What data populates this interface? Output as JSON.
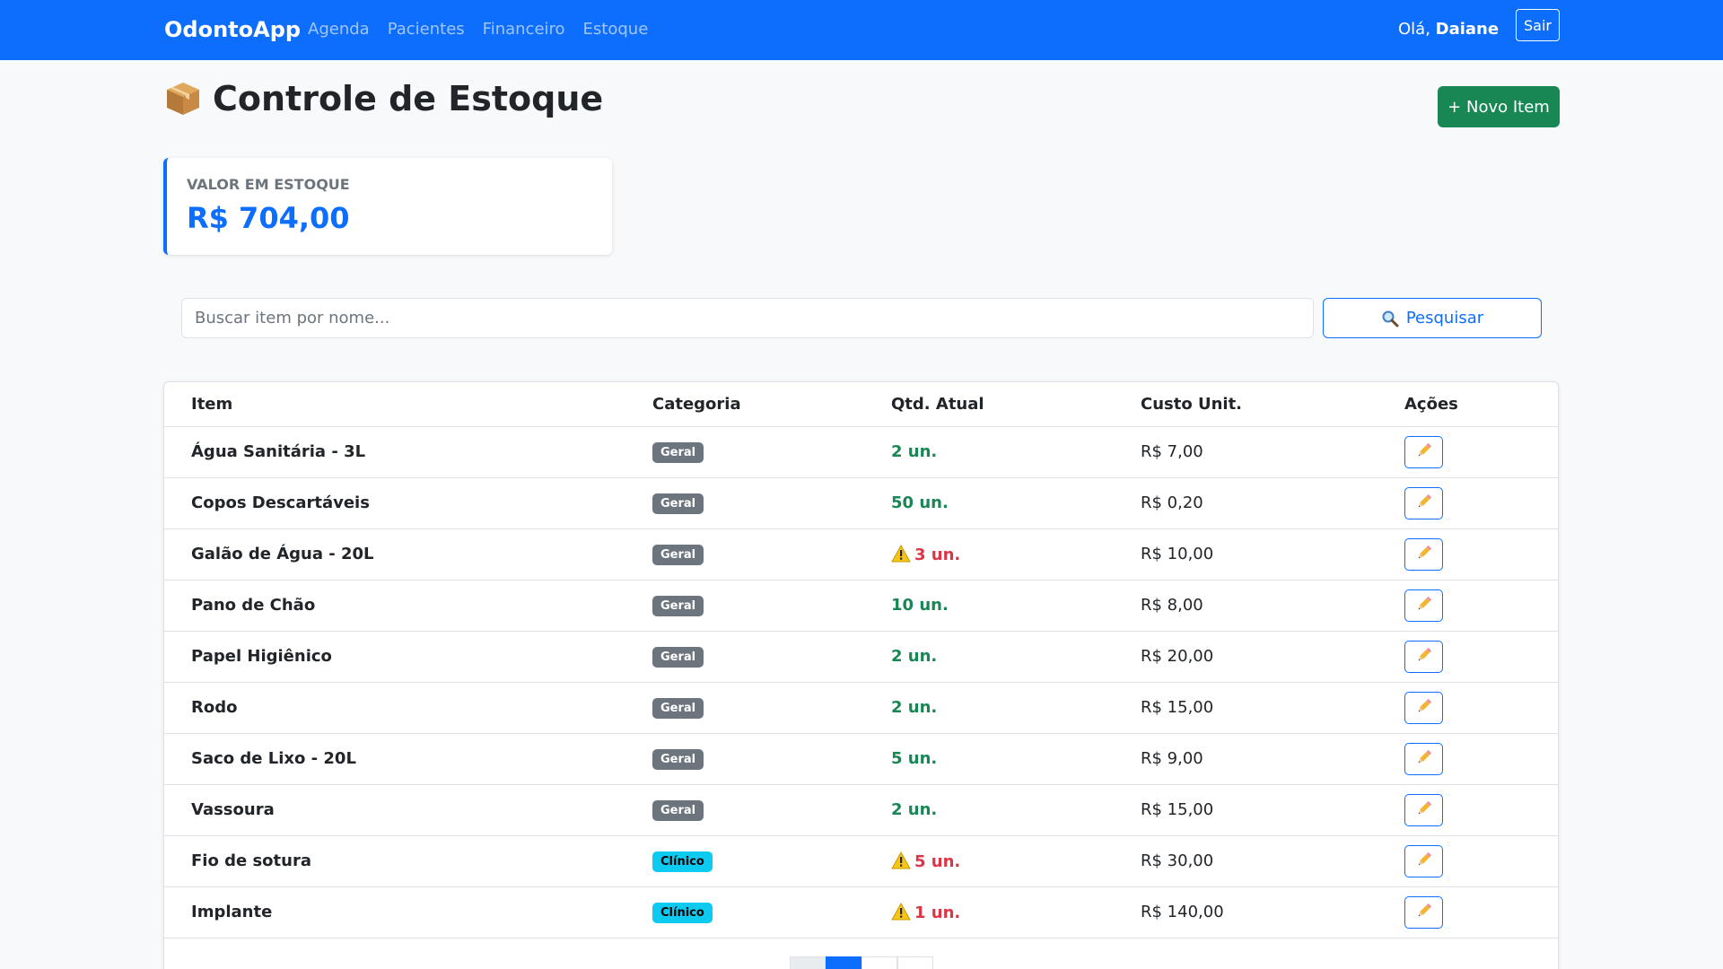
{
  "navbar": {
    "brand": "OdontoApp",
    "links": [
      "Agenda",
      "Pacientes",
      "Financeiro",
      "Estoque"
    ],
    "greeting_prefix": "Olá,",
    "user_name": "Daiane",
    "logout_label": "Sair"
  },
  "header": {
    "title": "Controle de Estoque",
    "title_icon": "package-icon",
    "new_item_label": "+ Novo Item"
  },
  "stat": {
    "label": "VALOR EM ESTOQUE",
    "value": "R$ 704,00"
  },
  "search": {
    "placeholder": "Buscar item por nome...",
    "value": "",
    "button_label": "Pesquisar"
  },
  "table": {
    "columns": [
      "Item",
      "Categoria",
      "Qtd. Atual",
      "Custo Unit.",
      "Ações"
    ],
    "rows": [
      {
        "item": "Água Sanitária - 3L",
        "category": "Geral",
        "qty": "2 un.",
        "low": false,
        "cost": "R$ 7,00"
      },
      {
        "item": "Copos Descartáveis",
        "category": "Geral",
        "qty": "50 un.",
        "low": false,
        "cost": "R$ 0,20"
      },
      {
        "item": "Galão de Água - 20L",
        "category": "Geral",
        "qty": "3 un.",
        "low": true,
        "cost": "R$ 10,00"
      },
      {
        "item": "Pano de Chão",
        "category": "Geral",
        "qty": "10 un.",
        "low": false,
        "cost": "R$ 8,00"
      },
      {
        "item": "Papel Higiênico",
        "category": "Geral",
        "qty": "2 un.",
        "low": false,
        "cost": "R$ 20,00"
      },
      {
        "item": "Rodo",
        "category": "Geral",
        "qty": "2 un.",
        "low": false,
        "cost": "R$ 15,00"
      },
      {
        "item": "Saco de Lixo - 20L",
        "category": "Geral",
        "qty": "5 un.",
        "low": false,
        "cost": "R$ 9,00"
      },
      {
        "item": "Vassoura",
        "category": "Geral",
        "qty": "2 un.",
        "low": false,
        "cost": "R$ 15,00"
      },
      {
        "item": "Fio de sotura",
        "category": "Clínico",
        "qty": "5 un.",
        "low": true,
        "cost": "R$ 30,00"
      },
      {
        "item": "Implante",
        "category": "Clínico",
        "qty": "1 un.",
        "low": true,
        "cost": "R$ 140,00"
      }
    ]
  },
  "colors": {
    "primary": "#0d6efd",
    "success": "#198754",
    "danger": "#dc3545",
    "badge_geral": "#6c757d",
    "badge_clinico": "#0dcaf0"
  },
  "icons": {
    "search": "magnifier-icon",
    "edit": "pencil-icon",
    "low_stock": "warning-icon"
  }
}
